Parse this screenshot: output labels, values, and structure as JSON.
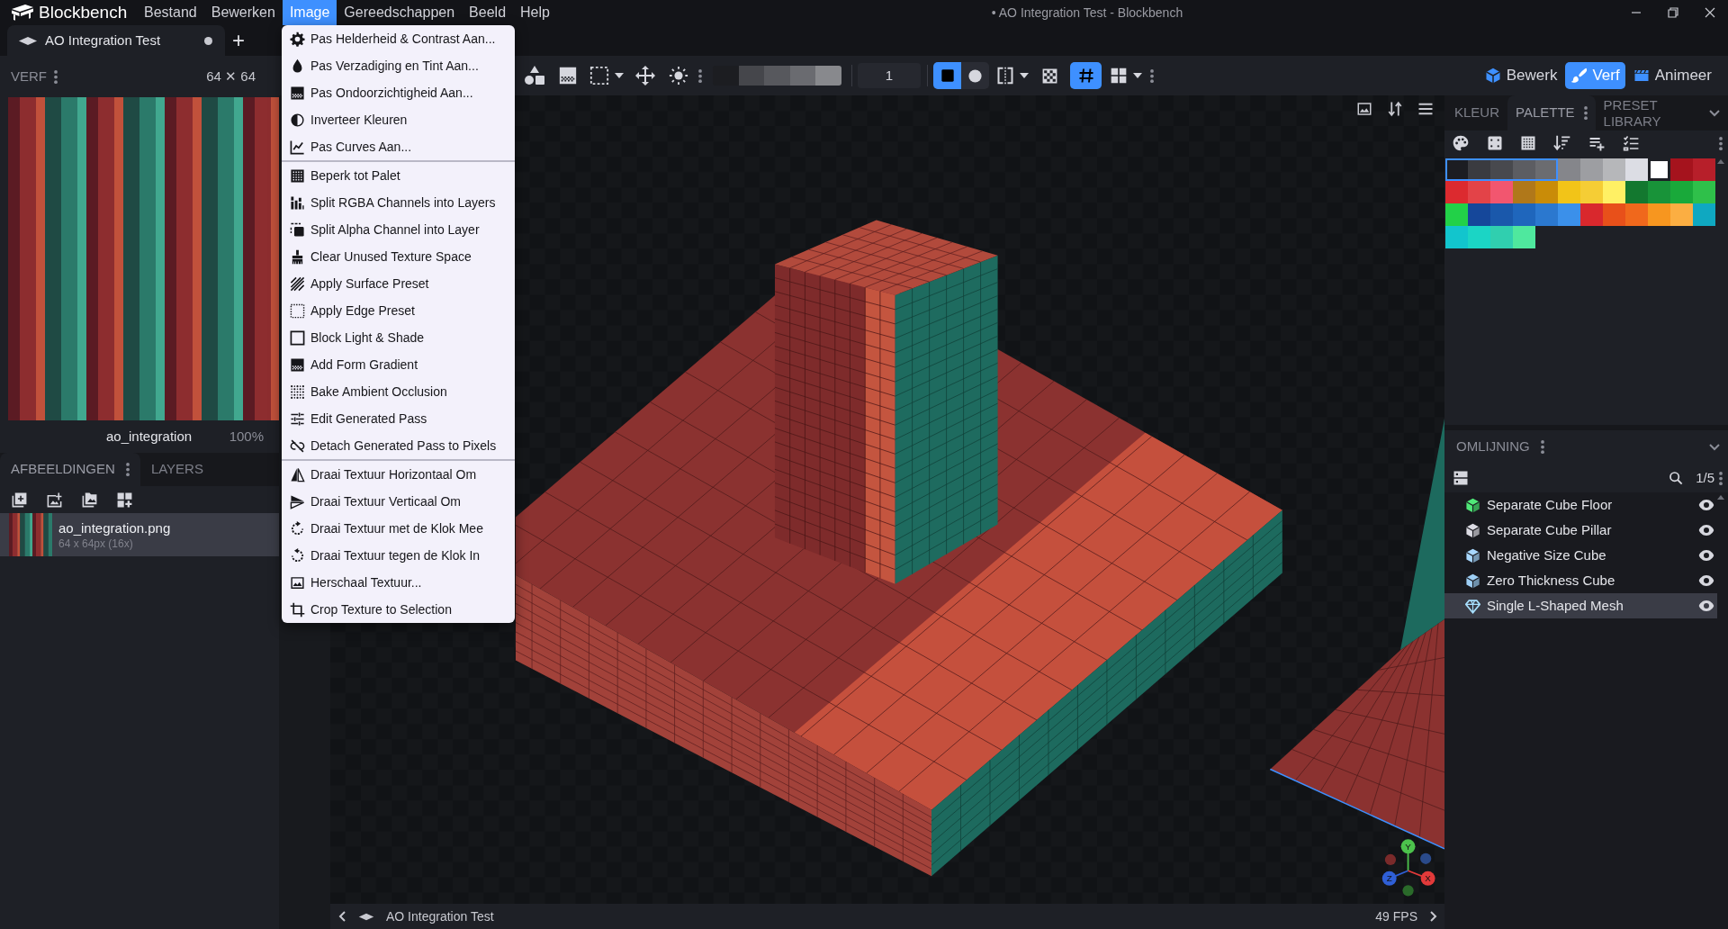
{
  "app": {
    "name": "Blockbench"
  },
  "menu_bar": [
    {
      "label": "Bestand",
      "selected": false
    },
    {
      "label": "Bewerken",
      "selected": false
    },
    {
      "label": "Image",
      "selected": true
    },
    {
      "label": "Gereedschappen",
      "selected": false
    },
    {
      "label": "Beeld",
      "selected": false
    },
    {
      "label": "Help",
      "selected": false
    }
  ],
  "window": {
    "title": "• AO Integration Test - Blockbench"
  },
  "project_tabs": [
    {
      "label": "AO Integration Test",
      "selected": true,
      "unsaved": true
    }
  ],
  "new_tab": "+",
  "paint_panel": {
    "title": "VERF",
    "size": "64 ✕ 64",
    "texture_name": "ao_integration",
    "zoom": "100%"
  },
  "textures_panel": {
    "tabs": [
      {
        "label": "AFBEELDINGEN",
        "selected": true
      },
      {
        "label": "LAYERS",
        "selected": false
      }
    ],
    "textures": [
      {
        "name": "ao_integration.png",
        "info": "64 x 64px (16x)",
        "selected": true
      }
    ]
  },
  "image_menu": {
    "sections": [
      [
        "Pas Helderheid & Contrast Aan...",
        "Pas Verzadiging en Tint Aan...",
        "Pas Ondoorzichtigheid Aan...",
        "Inverteer Kleuren",
        "Pas Curves Aan..."
      ],
      [
        "Beperk tot Palet",
        "Split RGBA Channels into Layers",
        "Split Alpha Channel into Layer",
        "Clear Unused Texture Space",
        "Apply Surface Preset",
        "Apply Edge Preset",
        "Block Light & Shade",
        "Add Form Gradient",
        "Bake Ambient Occlusion",
        "Edit Generated Pass",
        "Detach Generated Pass to Pixels"
      ],
      [
        "Draai Textuur Horizontaal Om",
        "Draai Textuur Verticaal Om",
        "Draai Textuur met de Klok Mee",
        "Draai Textuur tegen de Klok In",
        "Herschaal Textuur...",
        "Crop Texture to Selection"
      ]
    ]
  },
  "toolbar": {
    "shade_swatches": [
      {
        "color": "#1c1d21"
      },
      {
        "color": "#45464b"
      },
      {
        "color": "#57585d"
      },
      {
        "color": "#6a6b70"
      },
      {
        "color": "#88898d"
      }
    ],
    "brush_size": "1",
    "brush_shapes": [
      {
        "kind": "square",
        "selected": true
      },
      {
        "kind": "circle",
        "selected": false
      }
    ],
    "pixel_grid": {
      "on": true
    }
  },
  "mode_tabs": [
    {
      "label": "Bewerk",
      "selected": false
    },
    {
      "label": "Verf",
      "selected": true
    },
    {
      "label": "Animeer",
      "selected": false
    }
  ],
  "color_panel": {
    "tabs": [
      {
        "label": "KLEUR",
        "selected": false
      },
      {
        "label": "PALETTE",
        "selected": true
      },
      {
        "label": "PRESET LIBRARY",
        "selected": false
      }
    ],
    "palette": [
      {
        "color": "#1c1d22",
        "selected": true,
        "current": false
      },
      {
        "color": "#3a3b40",
        "selected": true,
        "current": false
      },
      {
        "color": "#48494e",
        "selected": true,
        "current": false
      },
      {
        "color": "#5c5d62",
        "selected": true,
        "current": false
      },
      {
        "color": "#6b6c70",
        "selected": true,
        "current": false
      },
      {
        "color": "#85868b",
        "selected": false,
        "current": false
      },
      {
        "color": "#9d9ea2",
        "selected": false,
        "current": false
      },
      {
        "color": "#b6b7ba",
        "selected": false,
        "current": false
      },
      {
        "color": "#dcdde4",
        "selected": false,
        "current": false
      },
      {
        "color": "#ffffff",
        "selected": false,
        "current": true
      },
      {
        "color": "#a5131d",
        "selected": false,
        "current": false
      },
      {
        "color": "#b71f2a",
        "selected": false,
        "current": false
      },
      {
        "color": "#dc2a2f",
        "selected": false,
        "current": false
      },
      {
        "color": "#e34348",
        "selected": false,
        "current": false
      },
      {
        "color": "#f2566f",
        "selected": false,
        "current": false
      },
      {
        "color": "#b0781a",
        "selected": false,
        "current": false
      },
      {
        "color": "#c98c08",
        "selected": false,
        "current": false
      },
      {
        "color": "#f2c418",
        "selected": false,
        "current": false
      },
      {
        "color": "#f5cd35",
        "selected": false,
        "current": false
      },
      {
        "color": "#fff064",
        "selected": false,
        "current": false
      },
      {
        "color": "#13782f",
        "selected": false,
        "current": false
      },
      {
        "color": "#189339",
        "selected": false,
        "current": false
      },
      {
        "color": "#19a93a",
        "selected": false,
        "current": false
      },
      {
        "color": "#2fc04a",
        "selected": false,
        "current": false
      },
      {
        "color": "#22d148",
        "selected": false,
        "current": false
      },
      {
        "color": "#15479a",
        "selected": false,
        "current": false
      },
      {
        "color": "#1a58ab",
        "selected": false,
        "current": false
      },
      {
        "color": "#1f66bc",
        "selected": false,
        "current": false
      },
      {
        "color": "#2b78cf",
        "selected": false,
        "current": false
      },
      {
        "color": "#3b90ea",
        "selected": false,
        "current": false
      },
      {
        "color": "#d9282d",
        "selected": false,
        "current": false
      },
      {
        "color": "#e8501a",
        "selected": false,
        "current": false
      },
      {
        "color": "#f0681c",
        "selected": false,
        "current": false
      },
      {
        "color": "#f7961f",
        "selected": false,
        "current": false
      },
      {
        "color": "#fbae42",
        "selected": false,
        "current": false
      },
      {
        "color": "#0fa8c1",
        "selected": false,
        "current": false
      },
      {
        "color": "#12c5cd",
        "selected": false,
        "current": false
      },
      {
        "color": "#1bd5c5",
        "selected": false,
        "current": false
      },
      {
        "color": "#30cfaf",
        "selected": false,
        "current": false
      },
      {
        "color": "#4fe89e",
        "selected": false,
        "current": false
      }
    ]
  },
  "outliner": {
    "title": "OMLIJNING",
    "count": "1/5",
    "items": [
      {
        "name": "Separate Cube Floor",
        "kind": "cube",
        "color": "#50e878",
        "visible": true,
        "selected": false
      },
      {
        "name": "Separate Cube Pillar",
        "kind": "cube",
        "color": "#dcdce4",
        "visible": true,
        "selected": false
      },
      {
        "name": "Negative Size Cube",
        "kind": "cube",
        "color": "#a8d8ff",
        "visible": true,
        "selected": false
      },
      {
        "name": "Zero Thickness Cube",
        "kind": "cube",
        "color": "#9ecff5",
        "visible": true,
        "selected": false
      },
      {
        "name": "Single L-Shaped Mesh",
        "kind": "mesh",
        "color": "#a8e0ff",
        "visible": true,
        "selected": true
      }
    ]
  },
  "viewport": {
    "axis_labels": [
      "Y",
      "Z",
      "X"
    ]
  },
  "status_bar": {
    "project": "AO Integration Test",
    "fps": "49 FPS"
  }
}
